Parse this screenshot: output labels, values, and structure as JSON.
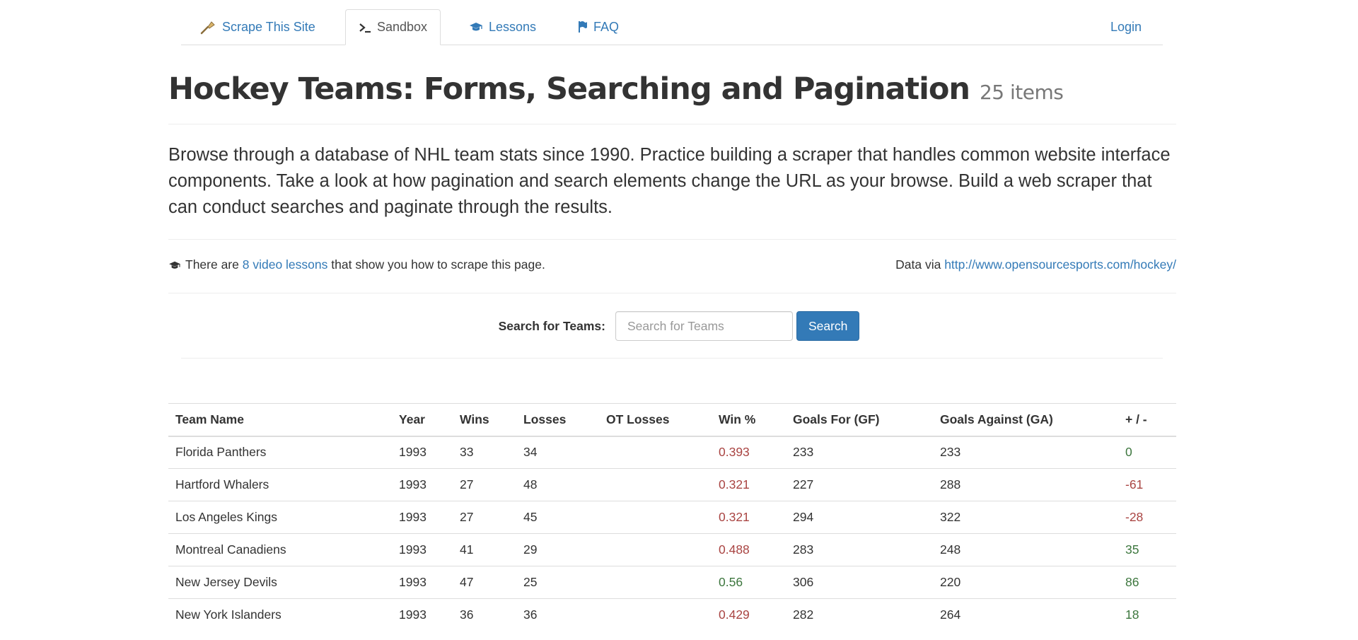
{
  "nav": {
    "brand": "Scrape This Site",
    "sandbox": "Sandbox",
    "lessons": "Lessons",
    "faq": "FAQ",
    "login": "Login"
  },
  "header": {
    "title": "Hockey Teams: Forms, Searching and Pagination",
    "count": "25 items"
  },
  "lead": "Browse through a database of NHL team stats since 1990. Practice building a scraper that handles common website interface components. Take a look at how pagination and search elements change the URL as your browse. Build a web scraper that can conduct searches and paginate through the results.",
  "info": {
    "prefix": "There are",
    "link": "8 video lessons",
    "suffix": "that show you how to scrape this page.",
    "data_via": "Data via",
    "data_link": "http://www.opensourcesports.com/hockey/"
  },
  "search": {
    "label": "Search for Teams:",
    "placeholder": "Search for Teams",
    "value": "",
    "button": "Search"
  },
  "table": {
    "headers": [
      "Team Name",
      "Year",
      "Wins",
      "Losses",
      "OT Losses",
      "Win %",
      "Goals For (GF)",
      "Goals Against (GA)",
      "+ / -"
    ],
    "rows": [
      {
        "name": "Florida Panthers",
        "year": "1993",
        "wins": "33",
        "losses": "34",
        "ot": "",
        "pct": "0.393",
        "gf": "233",
        "ga": "233",
        "diff": "0",
        "pct_status": "danger",
        "diff_status": "success"
      },
      {
        "name": "Hartford Whalers",
        "year": "1993",
        "wins": "27",
        "losses": "48",
        "ot": "",
        "pct": "0.321",
        "gf": "227",
        "ga": "288",
        "diff": "-61",
        "pct_status": "danger",
        "diff_status": "danger"
      },
      {
        "name": "Los Angeles Kings",
        "year": "1993",
        "wins": "27",
        "losses": "45",
        "ot": "",
        "pct": "0.321",
        "gf": "294",
        "ga": "322",
        "diff": "-28",
        "pct_status": "danger",
        "diff_status": "danger"
      },
      {
        "name": "Montreal Canadiens",
        "year": "1993",
        "wins": "41",
        "losses": "29",
        "ot": "",
        "pct": "0.488",
        "gf": "283",
        "ga": "248",
        "diff": "35",
        "pct_status": "danger",
        "diff_status": "success"
      },
      {
        "name": "New Jersey Devils",
        "year": "1993",
        "wins": "47",
        "losses": "25",
        "ot": "",
        "pct": "0.56",
        "gf": "306",
        "ga": "220",
        "diff": "86",
        "pct_status": "success",
        "diff_status": "success"
      },
      {
        "name": "New York Islanders",
        "year": "1993",
        "wins": "36",
        "losses": "36",
        "ot": "",
        "pct": "0.429",
        "gf": "282",
        "ga": "264",
        "diff": "18",
        "pct_status": "danger",
        "diff_status": "success"
      }
    ]
  },
  "colors": {
    "link": "#337ab7",
    "danger": "#a94442",
    "success": "#3c763d",
    "button": "#337ab7"
  }
}
